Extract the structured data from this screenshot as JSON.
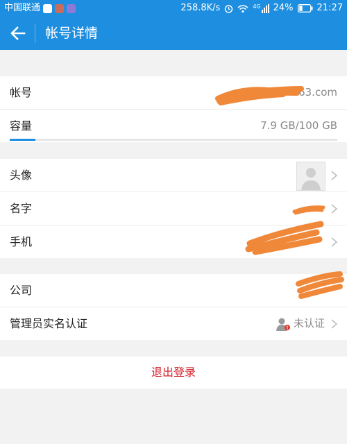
{
  "status_bar": {
    "carrier": "中国联通",
    "net_speed": "258.8K/s",
    "network": "4G",
    "battery": "24%",
    "time": "21:27"
  },
  "header": {
    "title": "帐号详情"
  },
  "account": {
    "label": "帐号",
    "value_visible": "63.com",
    "capacity_label": "容量",
    "capacity_value": "7.9 GB/100 GB",
    "capacity_fraction": 0.079
  },
  "profile": {
    "avatar_label": "头像",
    "name_label": "名字",
    "phone_label": "手机"
  },
  "company": {
    "company_label": "公司",
    "admin_label": "管理员实名认证",
    "admin_status": "未认证"
  },
  "logout_label": "退出登录",
  "colors": {
    "primary": "#1e8fe0",
    "logout": "#d3212c",
    "redaction": "#f0883a"
  }
}
